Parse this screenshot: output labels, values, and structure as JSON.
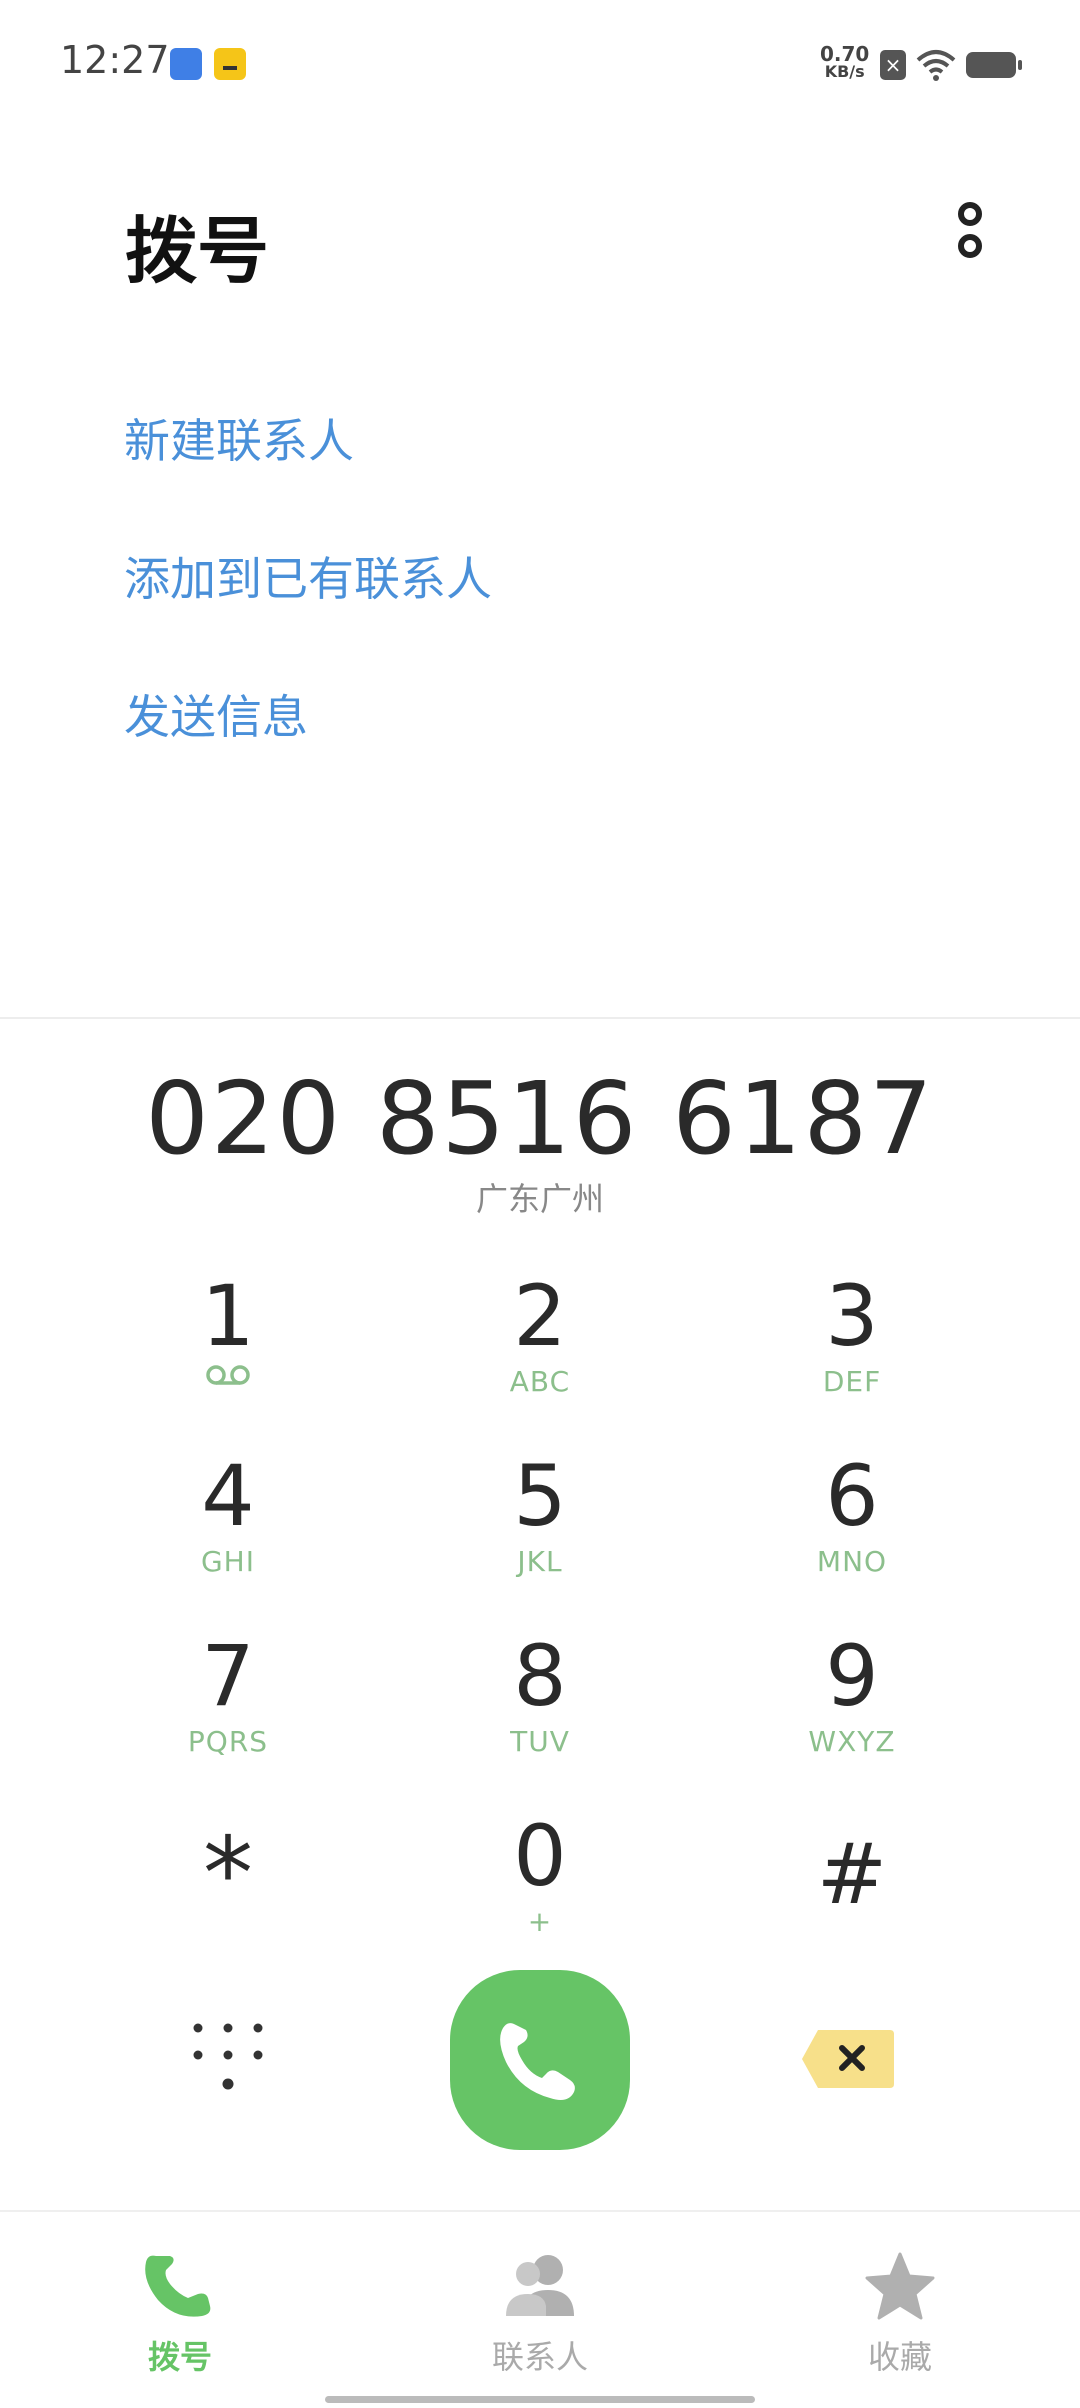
{
  "status_bar": {
    "time": "12:27",
    "net_speed_value": "0.70",
    "net_speed_unit": "KB/s"
  },
  "header": {
    "title": "拨号"
  },
  "actions": [
    {
      "label": "新建联系人"
    },
    {
      "label": "添加到已有联系人"
    },
    {
      "label": "发送信息"
    }
  ],
  "dialer": {
    "number": "020 8516 6187",
    "location": "广东广州"
  },
  "keypad": [
    {
      "digit": "1",
      "letters": ""
    },
    {
      "digit": "2",
      "letters": "ABC"
    },
    {
      "digit": "3",
      "letters": "DEF"
    },
    {
      "digit": "4",
      "letters": "GHI"
    },
    {
      "digit": "5",
      "letters": "JKL"
    },
    {
      "digit": "6",
      "letters": "MNO"
    },
    {
      "digit": "7",
      "letters": "PQRS"
    },
    {
      "digit": "8",
      "letters": "TUV"
    },
    {
      "digit": "9",
      "letters": "WXYZ"
    },
    {
      "digit": "*",
      "letters": ""
    },
    {
      "digit": "0",
      "letters": "+"
    },
    {
      "digit": "#",
      "letters": ""
    }
  ],
  "bottom_nav": [
    {
      "label": "拨号",
      "icon": "phone-icon",
      "active": true
    },
    {
      "label": "联系人",
      "icon": "contacts-icon",
      "active": false
    },
    {
      "label": "收藏",
      "icon": "star-icon",
      "active": false
    }
  ],
  "colors": {
    "accent_green": "#66c466",
    "link_blue": "#4a90d9",
    "letters_green": "#8cbf8c",
    "delete_yellow": "#f7e08a",
    "inactive_gray": "#aaaaaa"
  }
}
